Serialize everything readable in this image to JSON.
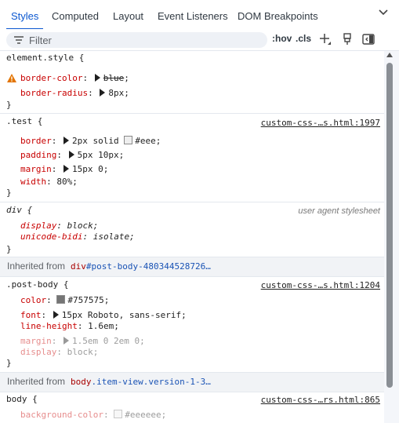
{
  "tabs": [
    {
      "label": "Styles",
      "active": true
    },
    {
      "label": "Computed",
      "active": false
    },
    {
      "label": "Layout",
      "active": false
    },
    {
      "label": "Event Listeners",
      "active": false
    },
    {
      "label": "DOM Breakpoints",
      "active": false
    }
  ],
  "toolbar": {
    "filter_placeholder": "Filter",
    "hov_label": ":hov",
    "cls_label": ".cls",
    "icons": [
      "filter-icon",
      "new-style-rule-icon",
      "element-state-icon",
      "toggle-sidebar-icon"
    ]
  },
  "rules": {
    "element_style": {
      "selector": "element.style {",
      "decls": [
        {
          "prop": "border-color",
          "value": "blue",
          "warning": true,
          "struck": true
        },
        {
          "prop": "border-radius",
          "value": "8px"
        }
      ],
      "close": "}"
    },
    "test": {
      "selector": ".test {",
      "source": "custom-css-…s.html:1997",
      "decls": [
        {
          "prop": "border",
          "value": "2px solid",
          "swatch_color": "#eeeeee",
          "swatch_text": "#eee;"
        },
        {
          "prop": "padding",
          "value": "5px 10px;"
        },
        {
          "prop": "margin",
          "value": "15px 0;"
        },
        {
          "prop": "width",
          "value": "80%;"
        }
      ],
      "close": "}"
    },
    "div": {
      "selector": "div {",
      "source": "user agent stylesheet",
      "decls": [
        {
          "prop": "display",
          "value": "block;"
        },
        {
          "prop": "unicode-bidi",
          "value": "isolate;"
        }
      ],
      "close": "}"
    },
    "inherited1": {
      "label": "Inherited from",
      "tag": "div",
      "rest": "#post-body-480344528726…"
    },
    "post_body": {
      "selector": ".post-body {",
      "source": "custom-css-…s.html:1204",
      "decls": [
        {
          "prop": "color",
          "swatch_color": "#757575",
          "value": "#757575;"
        },
        {
          "prop": "font",
          "value": "15px Roboto, sans-serif;"
        },
        {
          "prop": "line-height",
          "value": "1.6em;"
        },
        {
          "prop": "margin",
          "value": "1.5em 0 2em 0;",
          "inactive": true
        },
        {
          "prop": "display",
          "value": "block;",
          "inactive": true
        }
      ],
      "close": "}"
    },
    "inherited2": {
      "label": "Inherited from",
      "tag": "body",
      "rest": ".item-view.version-1-3…"
    },
    "body": {
      "selector": "body {",
      "source": "custom-css-…rs.html:865",
      "decls": [
        {
          "prop": "background-color",
          "swatch_color": "#eeeeee",
          "value": "#eeeeee;",
          "inactive": true
        }
      ]
    }
  },
  "colors": {
    "accent": "#0b57d0",
    "prop": "#c80000",
    "warning": "#e37400"
  }
}
